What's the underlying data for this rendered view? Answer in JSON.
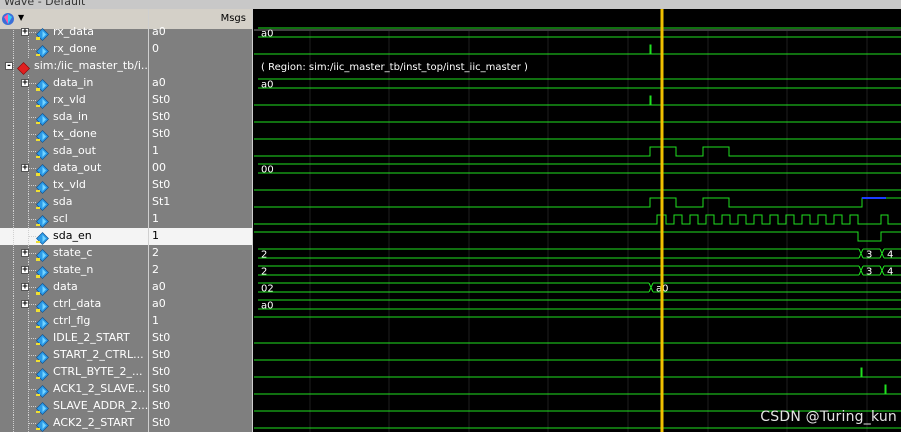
{
  "window": {
    "title": "Wave - Default"
  },
  "header": {
    "msgs_label": "Msgs"
  },
  "region_text": "( Region: sim:/iic_master_tb/inst_top/inst_iic_master )",
  "watermark": "CSDN @Turing_kun",
  "colors": {
    "wave": "#20e020",
    "cursor": "#f0c000",
    "grid": "#2a2a2a",
    "bus_z": "#1a3cff",
    "selected_row": "#f4f4f4"
  },
  "signals": [
    {
      "name": "rx_data",
      "value": "a0",
      "indent": 1,
      "expander": "+",
      "icon": "bus-signal-icon"
    },
    {
      "name": "rx_done",
      "value": "0",
      "indent": 1,
      "expander": "",
      "icon": "wire-signal-icon"
    },
    {
      "name": "sim:/iic_master_tb/i...",
      "value": "",
      "indent": 0,
      "expander": "-",
      "icon": "instance-region-icon"
    },
    {
      "name": "data_in",
      "value": "a0",
      "indent": 1,
      "expander": "+",
      "icon": "bus-signal-icon"
    },
    {
      "name": "rx_vld",
      "value": "St0",
      "indent": 1,
      "expander": "",
      "icon": "wire-signal-icon"
    },
    {
      "name": "sda_in",
      "value": "St0",
      "indent": 1,
      "expander": "",
      "icon": "wire-signal-icon"
    },
    {
      "name": "tx_done",
      "value": "St0",
      "indent": 1,
      "expander": "",
      "icon": "wire-signal-icon"
    },
    {
      "name": "sda_out",
      "value": "1",
      "indent": 1,
      "expander": "",
      "icon": "wire-signal-icon"
    },
    {
      "name": "data_out",
      "value": "00",
      "indent": 1,
      "expander": "+",
      "icon": "bus-signal-icon"
    },
    {
      "name": "tx_vld",
      "value": "St0",
      "indent": 1,
      "expander": "",
      "icon": "wire-signal-icon"
    },
    {
      "name": "sda",
      "value": "St1",
      "indent": 1,
      "expander": "",
      "icon": "wire-signal-icon"
    },
    {
      "name": "scl",
      "value": "1",
      "indent": 1,
      "expander": "",
      "icon": "wire-signal-icon"
    },
    {
      "name": "sda_en",
      "value": "1",
      "indent": 1,
      "expander": "",
      "icon": "wire-signal-icon",
      "selected": true
    },
    {
      "name": "state_c",
      "value": "2",
      "indent": 1,
      "expander": "+",
      "icon": "bus-signal-icon"
    },
    {
      "name": "state_n",
      "value": "2",
      "indent": 1,
      "expander": "+",
      "icon": "bus-signal-icon"
    },
    {
      "name": "data",
      "value": "a0",
      "indent": 1,
      "expander": "+",
      "icon": "bus-signal-icon"
    },
    {
      "name": "ctrl_data",
      "value": "a0",
      "indent": 1,
      "expander": "+",
      "icon": "bus-signal-icon"
    },
    {
      "name": "ctrl_flg",
      "value": "1",
      "indent": 1,
      "expander": "",
      "icon": "wire-signal-icon"
    },
    {
      "name": "IDLE_2_START",
      "value": "St0",
      "indent": 1,
      "expander": "",
      "icon": "wire-signal-icon"
    },
    {
      "name": "START_2_CTRL...",
      "value": "St0",
      "indent": 1,
      "expander": "",
      "icon": "wire-signal-icon"
    },
    {
      "name": "CTRL_BYTE_2_...",
      "value": "St0",
      "indent": 1,
      "expander": "",
      "icon": "wire-signal-icon"
    },
    {
      "name": "ACK1_2_SLAVE...",
      "value": "St0",
      "indent": 1,
      "expander": "",
      "icon": "wire-signal-icon"
    },
    {
      "name": "SLAVE_ADDR_2...",
      "value": "St0",
      "indent": 1,
      "expander": "",
      "icon": "wire-signal-icon"
    },
    {
      "name": "ACK2_2_START",
      "value": "St0",
      "indent": 1,
      "expander": "",
      "icon": "wire-signal-icon"
    }
  ],
  "bus_labels": {
    "rx_data": "a0",
    "data_in": "a0",
    "data_out": "00",
    "state_c": [
      "2",
      "3",
      "4"
    ],
    "state_n": [
      "2",
      "3",
      "4"
    ],
    "data": [
      "02",
      "a0"
    ],
    "ctrl_data": "a0"
  }
}
